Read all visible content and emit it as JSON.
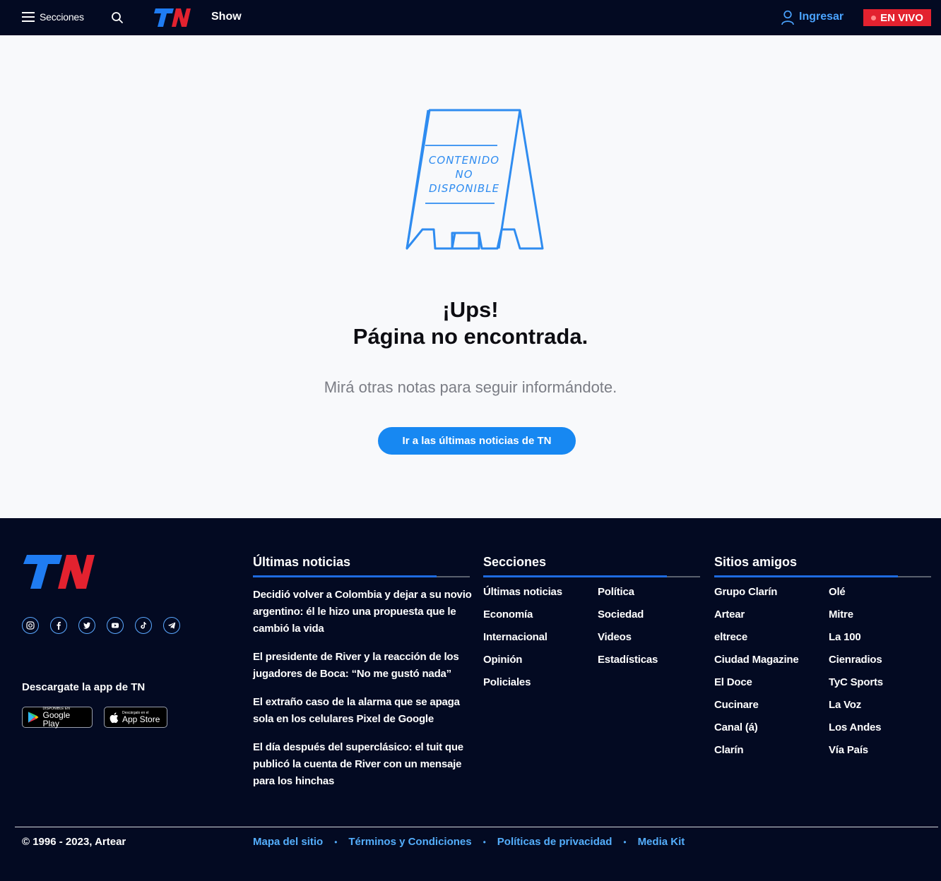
{
  "header": {
    "menu_label": "Secciones",
    "section": "Show",
    "login_label": "Ingresar",
    "live_label": "EN VIVO"
  },
  "main": {
    "title_line1": "¡Ups!",
    "title_line2": "Página no encontrada.",
    "subtitle": "Mirá otras notas para seguir informándote.",
    "cta_label": "Ir a las últimas noticias de TN",
    "sign_lines": [
      "CONTENIDO",
      "NO",
      "DISPONIBLE"
    ]
  },
  "footer": {
    "app_label": "Descargate la app de TN",
    "google_small": "DISPONIBLE EN",
    "google_big": "Google Play",
    "apple_small": "Descárgalo en el",
    "apple_big": "App Store",
    "socials": [
      "instagram-icon",
      "facebook-icon",
      "twitter-icon",
      "youtube-icon",
      "tiktok-icon",
      "telegram-icon"
    ],
    "news_title": "Últimas noticias",
    "news": [
      "Decidió volver a Colombia y dejar a su novio argentino: él le hizo una propuesta que le cambió la vida",
      "El presidente de River y la reacción de los jugadores de Boca: “No me gustó nada”",
      "El extraño caso de la alarma que se apaga sola en los celulares Pixel de Google",
      "El día después del superclásico: el tuit que publicó la cuenta de River con un mensaje para los hinchas"
    ],
    "sections_title": "Secciones",
    "sections_col1": [
      "Últimas noticias",
      "Economía",
      "Internacional",
      "Opinión",
      "Policiales"
    ],
    "sections_col2": [
      "Política",
      "Sociedad",
      "Videos",
      "Estadísticas"
    ],
    "friends_title": "Sitios amigos",
    "friends_col1": [
      "Grupo Clarín",
      "Artear",
      "eltrece",
      "Ciudad Magazine",
      "El Doce",
      "Cucinare",
      "Canal (á)",
      "Clarín"
    ],
    "friends_col2": [
      "Olé",
      "Mitre",
      "La 100",
      "Cienradios",
      "TyC Sports",
      "La Voz",
      "Los Andes",
      "Vía País"
    ],
    "copyright": "© 1996 - 2023, Artear",
    "bottom_links": [
      "Mapa del sitio",
      "Términos y Condiciones",
      "Políticas de privacidad",
      "Media Kit"
    ]
  },
  "colors": {
    "navy": "#030a22",
    "accent_blue": "#1788f2",
    "link_blue": "#54aefc",
    "live_red": "#e3222f",
    "logo_blue": "#1f7cf2",
    "logo_red": "#e3222f"
  }
}
